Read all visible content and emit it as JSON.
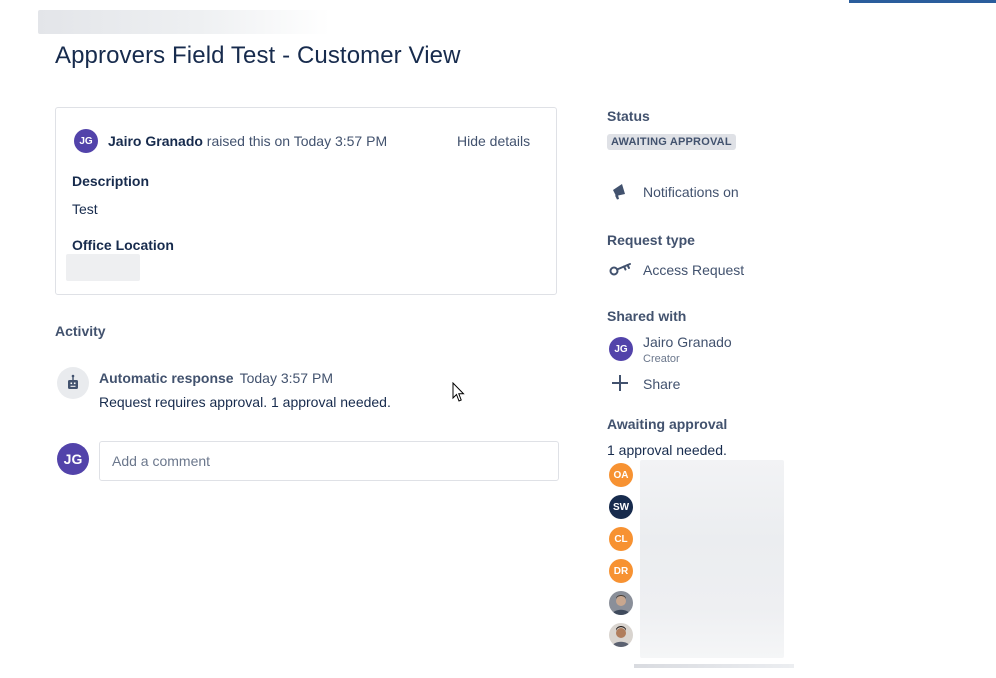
{
  "page": {
    "title": "Approvers Field Test - Customer View"
  },
  "request": {
    "reporter_initials": "JG",
    "reporter_name": "Jairo Granado",
    "raised_text": " raised this on Today 3:57 PM",
    "hide_details": "Hide details",
    "description_label": "Description",
    "description_value": "Test",
    "office_location_label": "Office Location"
  },
  "activity": {
    "label": "Activity",
    "entry": {
      "author": "Automatic response",
      "time": "Today 3:57 PM",
      "message": "Request requires approval. 1 approval needed."
    },
    "comment": {
      "avatar_initials": "JG",
      "placeholder": "Add a comment"
    }
  },
  "sidebar": {
    "status_label": "Status",
    "status_value": "AWAITING APPROVAL",
    "notifications": "Notifications on",
    "request_type_label": "Request type",
    "request_type_value": "Access Request",
    "shared_with_label": "Shared with",
    "shared_user": {
      "initials": "JG",
      "name": "Jairo Granado",
      "role": "Creator"
    },
    "share_label": "Share",
    "awaiting_approval_label": "Awaiting approval",
    "approval_needed": "1 approval needed.",
    "approvers": [
      {
        "initials": "OA",
        "color": "#f79232"
      },
      {
        "initials": "SW",
        "color": "#172b4d"
      },
      {
        "initials": "CL",
        "color": "#f79232"
      },
      {
        "initials": "DR",
        "color": "#f79232"
      }
    ]
  },
  "colors": {
    "avatar_purple": "#5243aa",
    "text_primary": "#172b4d",
    "text_secondary": "#42526e",
    "border": "#dfe1e6",
    "badge_bg": "#dfe1e6",
    "accent_bar": "#2a5d9c"
  }
}
